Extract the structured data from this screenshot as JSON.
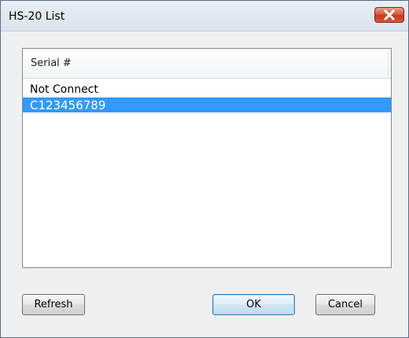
{
  "window": {
    "title": "HS-20 List",
    "close_icon": "close-x-icon"
  },
  "list": {
    "column_header": "Serial #",
    "rows": [
      {
        "label": "Not Connect",
        "selected": false
      },
      {
        "label": "C123456789",
        "selected": true
      }
    ]
  },
  "buttons": {
    "refresh_label": "Refresh",
    "ok_label": "OK",
    "cancel_label": "Cancel"
  },
  "colors": {
    "selection": "#3399ff",
    "close_button": "#c4391f",
    "title_bar": "#dbe3ec"
  }
}
